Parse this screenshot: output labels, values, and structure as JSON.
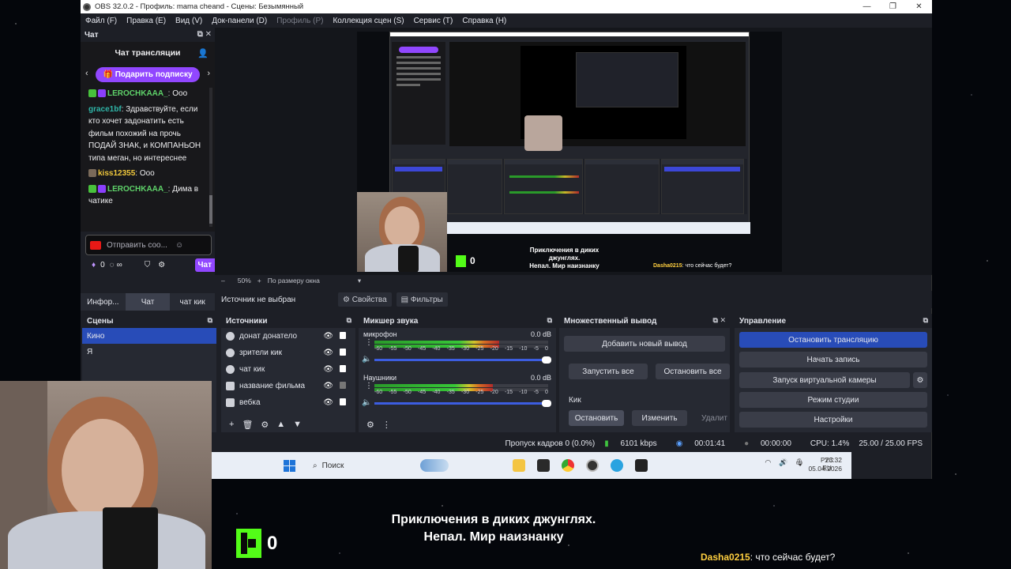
{
  "window": {
    "title": "OBS 32.0.2 - Профиль: mama cheand - Сцены: Безымянный",
    "controls": [
      "—",
      "❐",
      "✕"
    ]
  },
  "menu": [
    {
      "label": "Файл (F)",
      "disabled": false
    },
    {
      "label": "Правка (E)",
      "disabled": false
    },
    {
      "label": "Вид (V)",
      "disabled": false
    },
    {
      "label": "Док-панели (D)",
      "disabled": false
    },
    {
      "label": "Профиль (P)",
      "disabled": true
    },
    {
      "label": "Коллекция сцен (S)",
      "disabled": false
    },
    {
      "label": "Сервис (T)",
      "disabled": false
    },
    {
      "label": "Справка (H)",
      "disabled": false
    }
  ],
  "chat": {
    "dock_title": "Чат",
    "header": "Чат трансляции",
    "gift_button": "Подарить подписку",
    "messages": [
      {
        "user": "LEROCHKAAA_",
        "sep": ": ",
        "text": "Ооо"
      },
      {
        "user": "grace1bf",
        "sep": ": ",
        "text": "Здравствуйте, если кто хочет задонатить есть фильм похожий на прочь ПОДАЙ ЗНАК, и КОМПАНЬОН типа меган, но интереснее"
      },
      {
        "user": "kiss12355",
        "sep": ": ",
        "text": "Ооо"
      },
      {
        "user": "LEROCHKAAA_",
        "sep": ": ",
        "text": "Дима в чатике"
      }
    ],
    "send_placeholder": "Отправить соо...",
    "points": "0",
    "infinity": "∞",
    "chat_button": "Чат"
  },
  "left_tabs": [
    {
      "label": "Инфор...",
      "active": false
    },
    {
      "label": "Чат",
      "active": true
    },
    {
      "label": "чат кик",
      "active": false
    }
  ],
  "preview": {
    "zoom_minus": "–",
    "zoom": "50%",
    "zoom_plus": "+",
    "fit": "По размеру окна",
    "kick_count": "0",
    "caption_line1": "Приключения в диких джунглях.",
    "caption_line2": "Непал. Мир наизнанку",
    "chat_user": "Dasha0215",
    "chat_text": ": что сейчас будет?"
  },
  "source_toolbar": {
    "no_source": "Источник не выбран",
    "properties": "Свойства",
    "filters": "Фильтры"
  },
  "scenes": {
    "title": "Сцены",
    "items": [
      {
        "label": "Кино",
        "selected": true
      },
      {
        "label": "Я",
        "selected": false
      }
    ]
  },
  "sources": {
    "title": "Источники",
    "items": [
      {
        "label": "донат донатело",
        "icon": "globe-icon",
        "locked": true
      },
      {
        "label": "зрители кик",
        "icon": "globe-icon",
        "locked": true
      },
      {
        "label": "чат кик",
        "icon": "globe-icon",
        "locked": true
      },
      {
        "label": "название фильма",
        "icon": "group-icon",
        "locked": false
      },
      {
        "label": "вебка",
        "icon": "camera-icon",
        "locked": true
      }
    ]
  },
  "mixer": {
    "title": "Микшер звука",
    "scale": [
      "-60",
      "-55",
      "-50",
      "-45",
      "-40",
      "-35",
      "-30",
      "-25",
      "-20",
      "-15",
      "-10",
      "-5",
      "0"
    ],
    "channels": [
      {
        "name": "микрофон",
        "db": "0.0 dB",
        "level": 0.72
      },
      {
        "name": "Наушники",
        "db": "0.0 dB",
        "level": 0.68
      }
    ]
  },
  "multi_output": {
    "title": "Множественный вывод",
    "add": "Добавить новый вывод",
    "start_all": "Запустить все",
    "stop_all": "Остановить все",
    "target": "Кик",
    "stop": "Остановить",
    "edit": "Изменить",
    "delete": "Удалит"
  },
  "controls": {
    "title": "Управление",
    "stop_stream": "Остановить трансляцию",
    "start_record": "Начать запись",
    "virtual_cam": "Запуск виртуальной камеры",
    "studio_mode": "Режим студии",
    "settings": "Настройки"
  },
  "status": {
    "dropped": "Пропуск кадров 0 (0.0%)",
    "bitrate": "6101 kbps",
    "stream_time": "00:01:41",
    "rec_time": "00:00:00",
    "cpu": "CPU: 1.4%",
    "fps": "25.00 / 25.00 FPS"
  },
  "taskbar": {
    "search": "Поиск",
    "lang1": "РУС",
    "lang2": "RU",
    "time": "23:32",
    "date": "05.04.2026"
  },
  "overlay": {
    "kick_count": "0",
    "caption_line1": "Приключения в диких джунглях.",
    "caption_line2": "Непал. Мир наизнанку",
    "chat_user": "Dasha0215",
    "chat_text": ": что сейчас будет?"
  },
  "colors": {
    "accent_blue": "#284cb8",
    "twitch_purple": "#9147ff",
    "kick_green": "#53fc18",
    "obs_bg": "#1d1f26"
  }
}
